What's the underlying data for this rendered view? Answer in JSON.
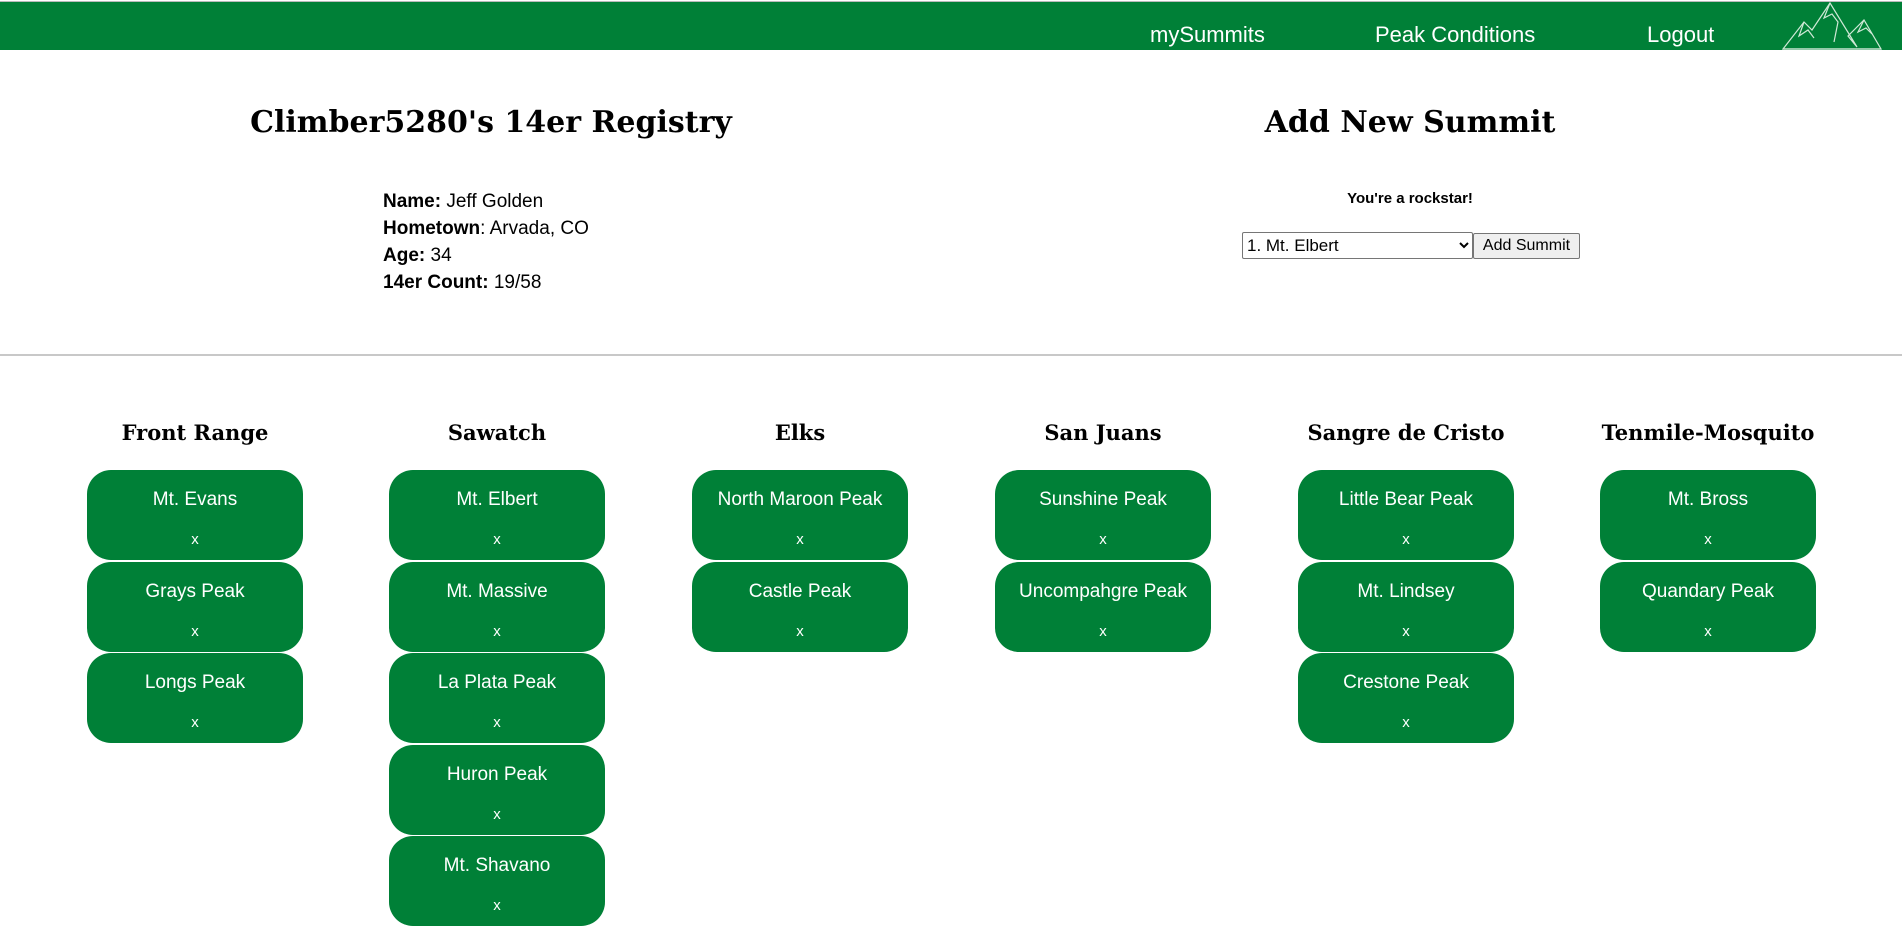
{
  "nav": {
    "items": [
      "mySummits",
      "Peak Conditions",
      "Logout"
    ],
    "logo_icon": "mountain-logo-icon"
  },
  "profile": {
    "title": "Climber5280's 14er Registry",
    "fields": [
      {
        "label": "Name:",
        "value": "Jeff Golden"
      },
      {
        "label": "Hometown",
        "value": ": Arvada, CO"
      },
      {
        "label": "Age:",
        "value": "34"
      },
      {
        "label": "14er Count:",
        "value": "19/58"
      }
    ]
  },
  "add_summit": {
    "title": "Add New Summit",
    "message": "You're a rockstar!",
    "selected": "1. Mt. Elbert",
    "button": "Add Summit"
  },
  "ranges": [
    {
      "name": "Front Range",
      "peaks": [
        "Mt. Evans",
        "Grays Peak",
        "Longs Peak"
      ]
    },
    {
      "name": "Sawatch",
      "peaks": [
        "Mt. Elbert",
        "Mt. Massive",
        "La Plata Peak",
        "Huron Peak",
        "Mt. Shavano"
      ]
    },
    {
      "name": "Elks",
      "peaks": [
        "North Maroon Peak",
        "Castle Peak"
      ]
    },
    {
      "name": "San Juans",
      "peaks": [
        "Sunshine Peak",
        "Uncompahgre Peak"
      ]
    },
    {
      "name": "Sangre de Cristo",
      "peaks": [
        "Little Bear Peak",
        "Mt. Lindsey",
        "Crestone Peak"
      ]
    },
    {
      "name": "Tenmile-Mosquito",
      "peaks": [
        "Mt. Bross",
        "Quandary Peak"
      ]
    }
  ],
  "remove_label": "x",
  "colors": {
    "brand": "#008037"
  }
}
